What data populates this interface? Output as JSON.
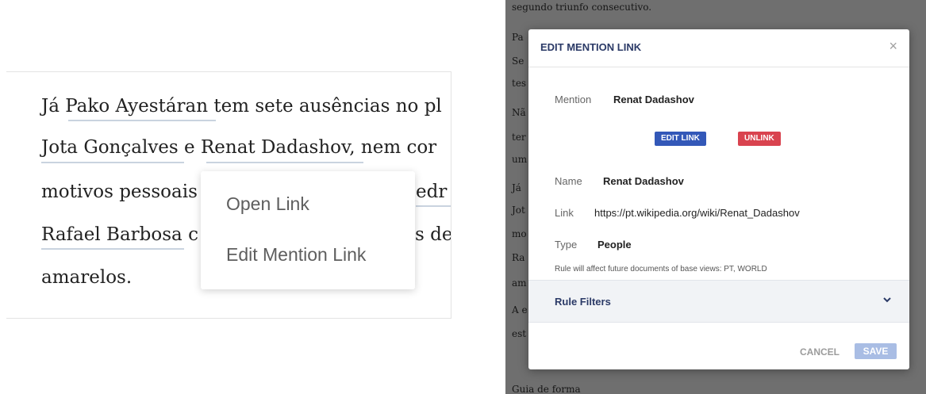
{
  "article": {
    "line1": "Já Pako Ayestáran tem sete ausências no pl",
    "line2": "Jota Gonçalves e Renat Dadashov, nem cor",
    "line3_a": "motivos pessoais",
    "line3_b": "edr",
    "line4_a": "Rafael Barbosa c",
    "line4_b": "s de",
    "line5": "amarelos."
  },
  "context_menu": {
    "open_link": "Open Link",
    "edit_mention_link": "Edit Mention Link"
  },
  "background_doc": {
    "lines": [
      "segundo triunfo consecutivo.",
      "Pa",
      "Se",
      "tes",
      "Nã",
      "ter",
      "um",
      "Já",
      "Jot",
      "mo",
      "Ra",
      "am",
      "A e",
      "est"
    ],
    "footer": "Guia de forma"
  },
  "modal": {
    "title": "EDIT MENTION LINK",
    "close_icon": "close-icon",
    "mention_label": "Mention",
    "mention_value": "Renat Dadashov",
    "edit_link_button": "EDIT LINK",
    "unlink_button": "UNLINK",
    "name_label": "Name",
    "name_value": "Renat Dadashov",
    "link_label": "Link",
    "link_value": "https://pt.wikipedia.org/wiki/Renat_Dadashov",
    "type_label": "Type",
    "type_value": "People",
    "rule_note": "Rule will affect future documents of base views: PT, WORLD",
    "rule_filters_label": "Rule Filters",
    "rule_filters_icon": "chevron-down-icon",
    "cancel_button": "CANCEL",
    "save_button": "SAVE"
  },
  "colors": {
    "edit_link": "#3358b8",
    "unlink": "#d9434f",
    "title": "#2b3a67",
    "overlay": "#6f6f6f",
    "save_disabled": "#a9bde4"
  }
}
